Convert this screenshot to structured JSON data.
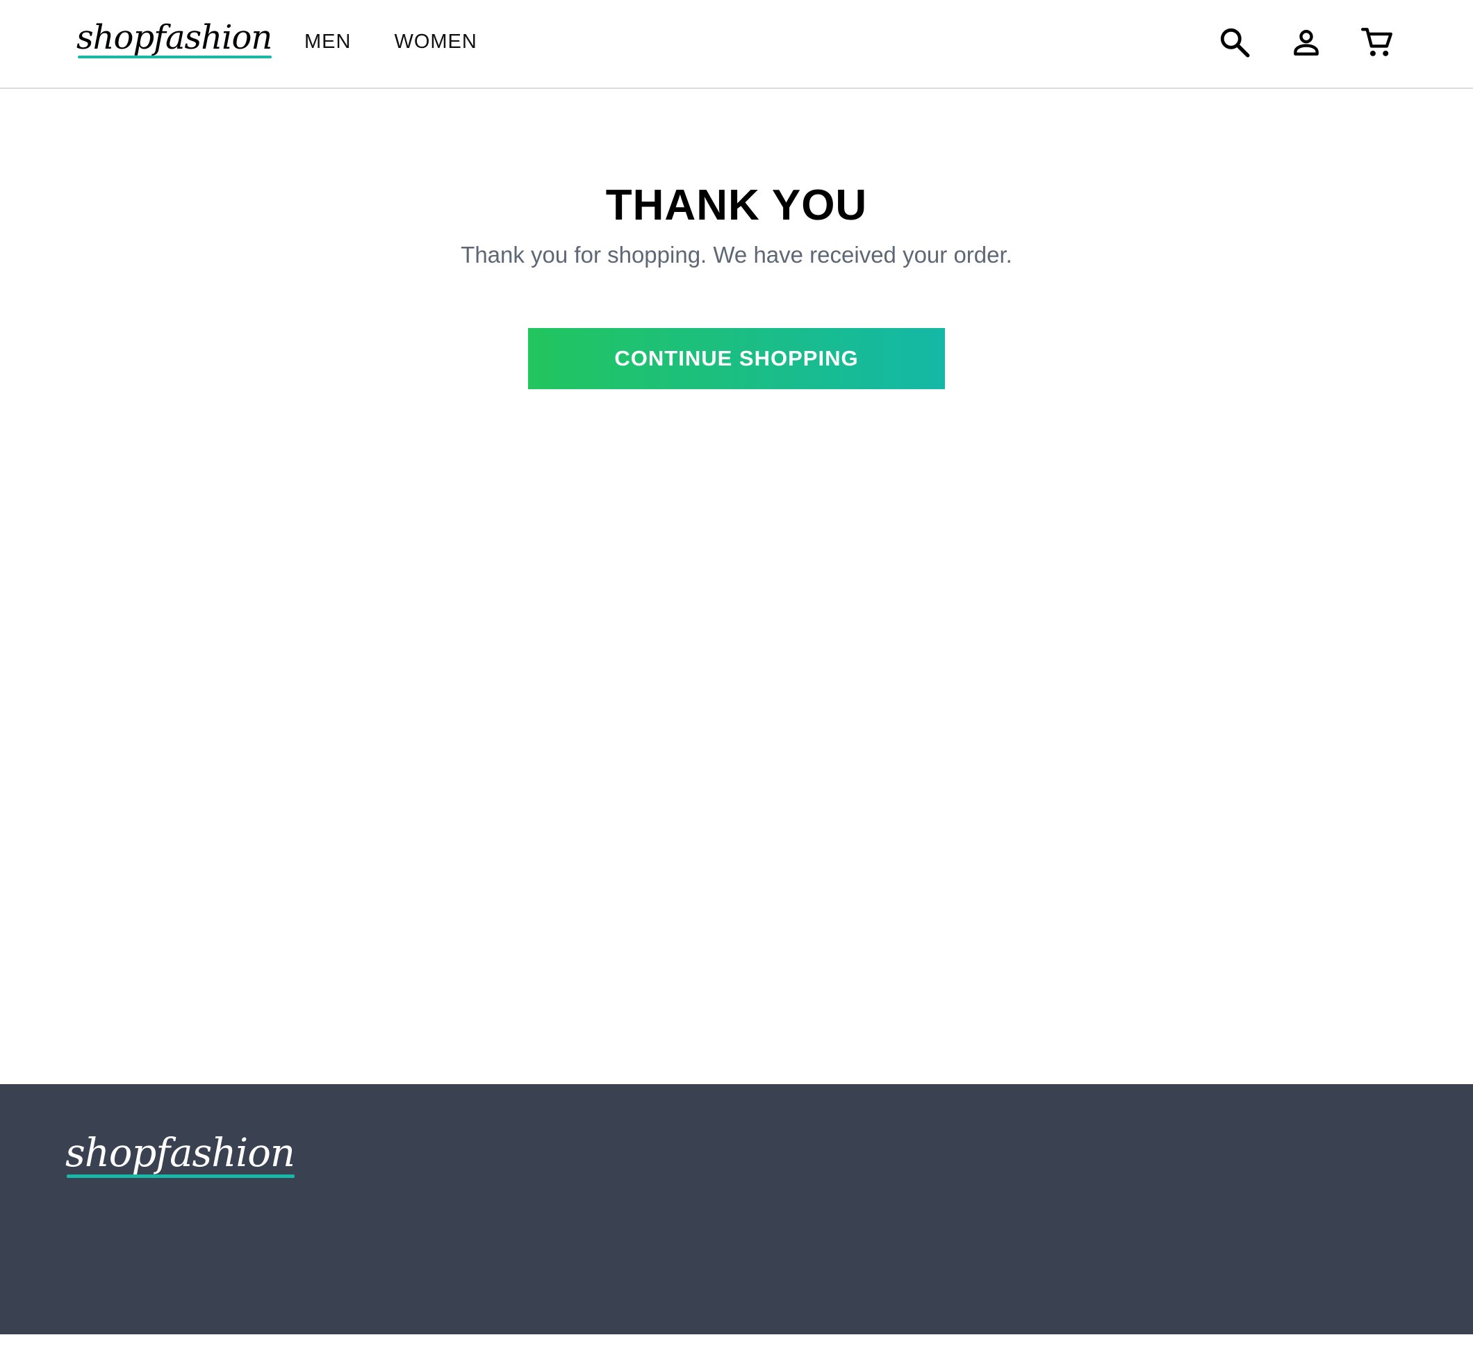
{
  "header": {
    "brand": "shopfashion",
    "nav": [
      {
        "label": "MEN"
      },
      {
        "label": "WOMEN"
      }
    ],
    "icons": [
      "search-icon",
      "account-icon",
      "cart-icon"
    ]
  },
  "main": {
    "title": "THANK YOU",
    "message": "Thank you for shopping. We have received your order.",
    "continue_label": "CONTINUE SHOPPING"
  },
  "footer": {
    "brand": "shopfashion"
  },
  "colors": {
    "accent_start": "#22c55e",
    "accent_end": "#14b8a6",
    "logo_underline": "#17b8a6",
    "footer_bg": "#3a4252",
    "message_text": "#5d6776"
  }
}
